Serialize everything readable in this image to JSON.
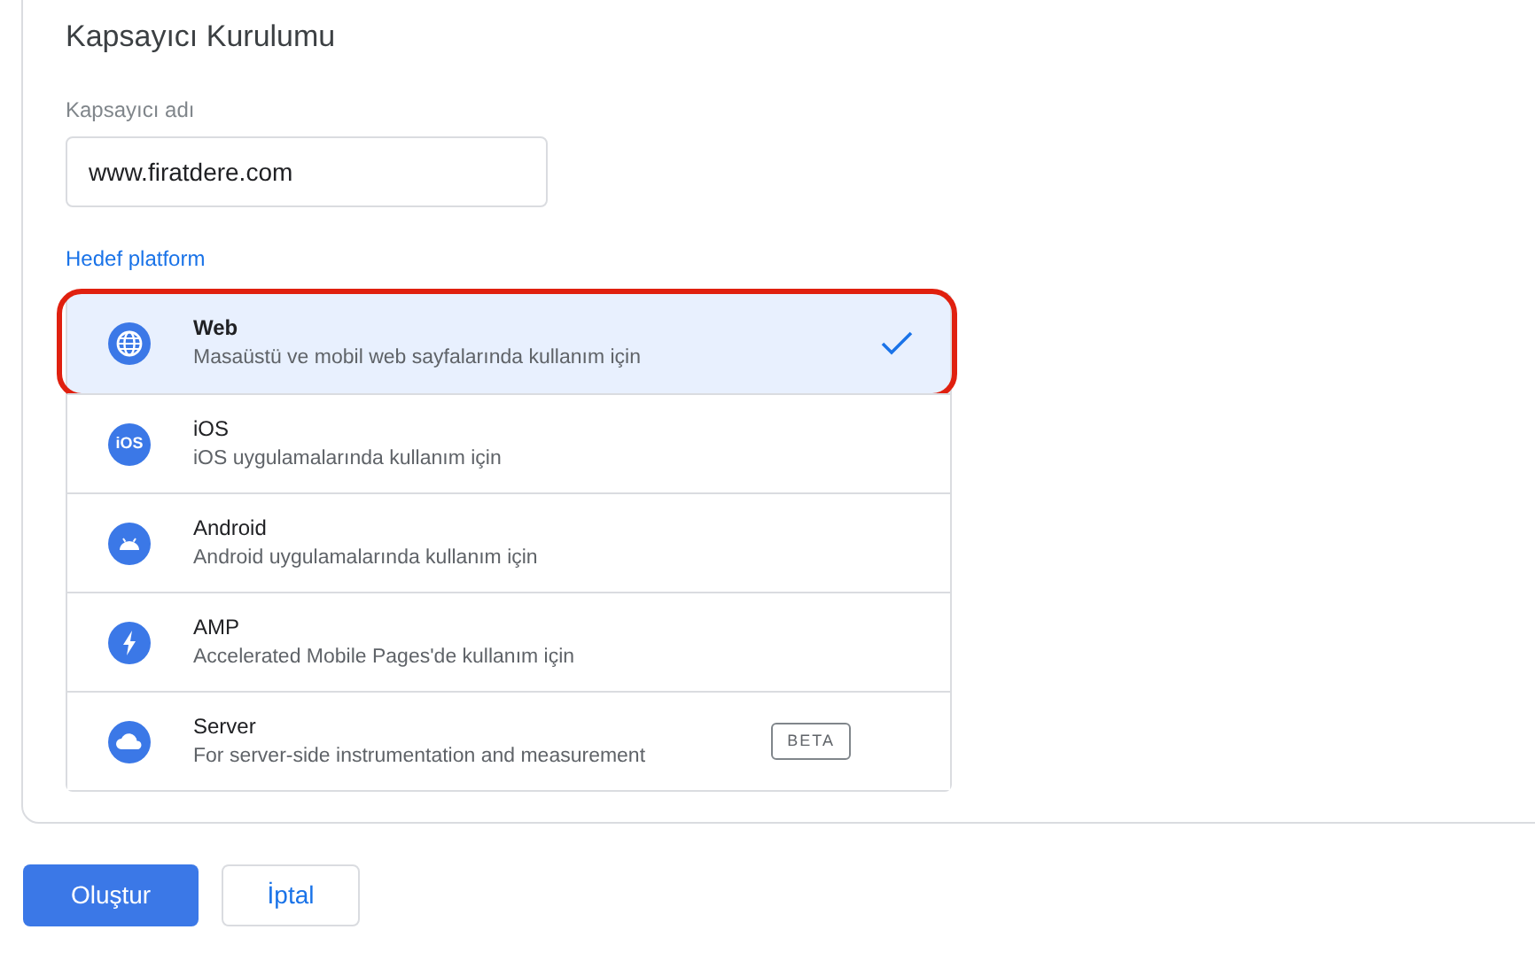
{
  "card": {
    "title": "Kapsayıcı Kurulumu",
    "name_field": {
      "label": "Kapsayıcı adı",
      "value": "www.firatdere.com"
    },
    "platform_label": "Hedef platform",
    "platforms": [
      {
        "kind": "globe",
        "name": "Web",
        "description": "Masaüstü ve mobil web sayfalarında kullanım için",
        "selected": true,
        "highlighted": true
      },
      {
        "kind": "ios",
        "icon_text": "iOS",
        "name": "iOS",
        "description": "iOS uygulamalarında kullanım için",
        "selected": false,
        "highlighted": false
      },
      {
        "kind": "android",
        "name": "Android",
        "description": "Android uygulamalarında kullanım için",
        "selected": false,
        "highlighted": false
      },
      {
        "kind": "bolt",
        "name": "AMP",
        "description": "Accelerated Mobile Pages'de kullanım için",
        "selected": false,
        "highlighted": false
      },
      {
        "kind": "cloud",
        "name": "Server",
        "description": "For server-side instrumentation and measurement",
        "badge": "BETA",
        "selected": false,
        "highlighted": false
      }
    ]
  },
  "buttons": [
    {
      "kind": "primary",
      "label": "Oluştur"
    },
    {
      "kind": "secondary",
      "label": "İptal"
    }
  ]
}
